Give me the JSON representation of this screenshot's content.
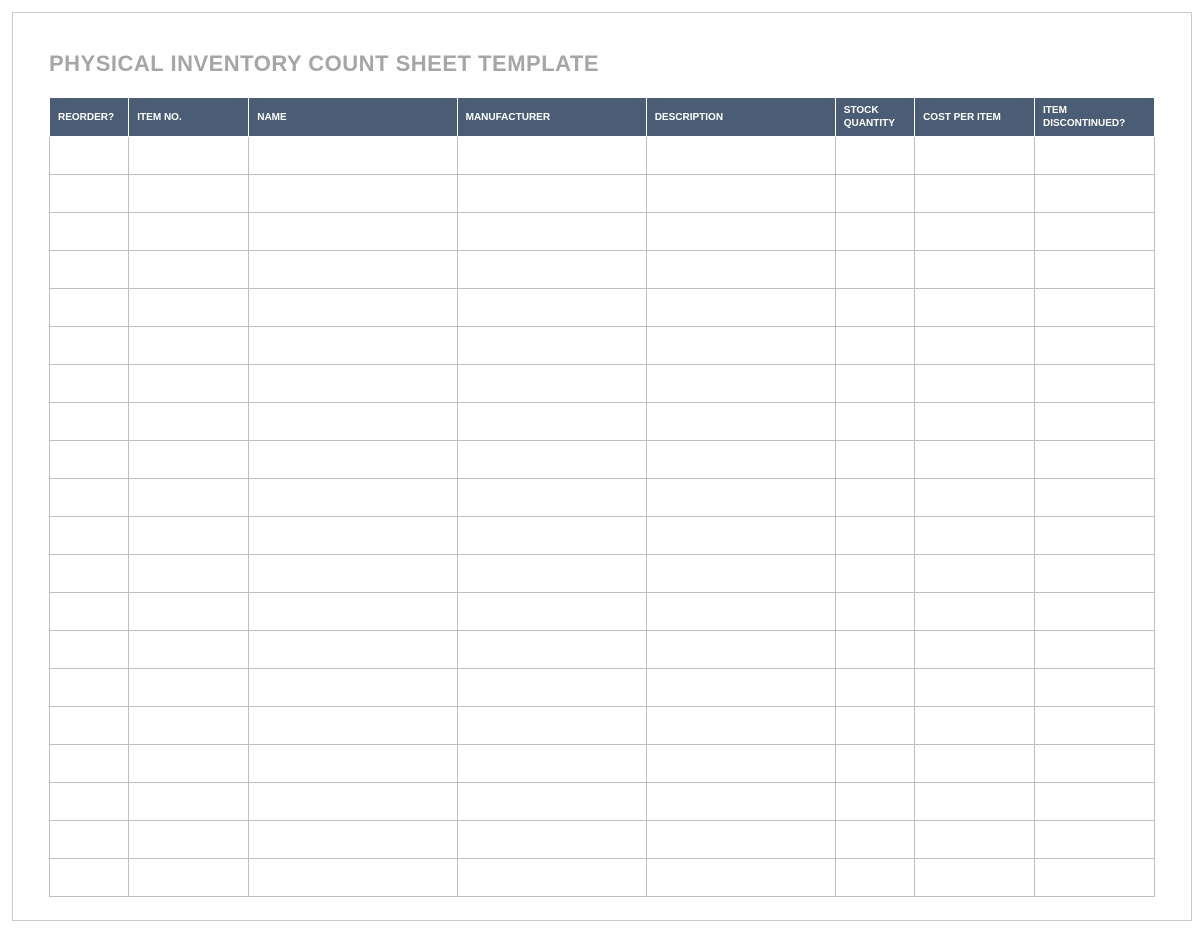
{
  "title": "PHYSICAL INVENTORY COUNT SHEET TEMPLATE",
  "columns": {
    "reorder": "REORDER?",
    "itemno": "ITEM NO.",
    "name": "NAME",
    "manufacturer": "MANUFACTURER",
    "description": "DESCRIPTION",
    "stock": "STOCK QUANTITY",
    "cost": "COST PER ITEM",
    "discontinued": "ITEM DISCONTINUED?"
  },
  "colors": {
    "header_bg": "#4a5d75",
    "header_text": "#ffffff",
    "title_text": "#a6a6a6",
    "border": "#bfbfbf"
  },
  "row_count": 20
}
